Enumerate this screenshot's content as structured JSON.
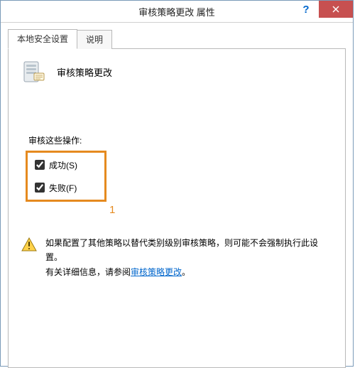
{
  "window": {
    "title": "审核策略更改 属性",
    "help": "?",
    "close_aria": "Close"
  },
  "tabs": {
    "t0": "本地安全设置",
    "t1": "说明"
  },
  "panel": {
    "header": "审核策略更改",
    "audit_label": "审核这些操作:",
    "success": "成功(S)",
    "failure": "失败(F)"
  },
  "annotation": {
    "n1": "1"
  },
  "warn": {
    "line1": "如果配置了其他策略以替代类别级别审核策略，则可能不会强制执行此设置。",
    "line2a": "有关详细信息，请参阅",
    "link": "审核策略更改",
    "line2b": "。"
  }
}
